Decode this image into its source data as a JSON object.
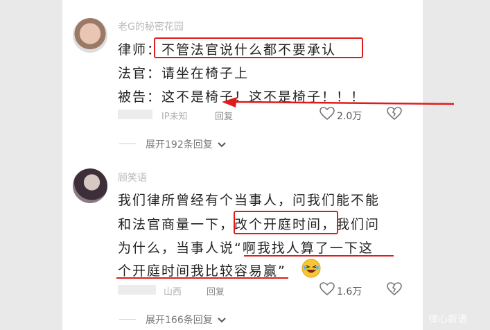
{
  "comments": [
    {
      "username": "老G的秘密花园",
      "lines": [
        "律师：不管法官说什么都不要承认",
        "法官：请坐在椅子上",
        "被告：这不是椅子！这不是椅子！！！"
      ],
      "location": "IP未知",
      "reply_label": "回复",
      "likes": "2.0万",
      "expand": "展开192条回复"
    },
    {
      "username": "顾笑语",
      "lines": [
        "我们律所曾经有个当事人，问我们能不能",
        "和法官商量一下，改个开庭时间，我们问",
        "为什么，当事人说“啊我找人算了一下这",
        "个开庭时间我比较容易赢”"
      ],
      "location": "山西",
      "reply_label": "回复",
      "likes": "1.6万",
      "expand": "展开166条回复"
    }
  ],
  "watermark": "律心新语",
  "colors": {
    "annotation": "#e11b1b",
    "background": "#e9e9ea"
  }
}
